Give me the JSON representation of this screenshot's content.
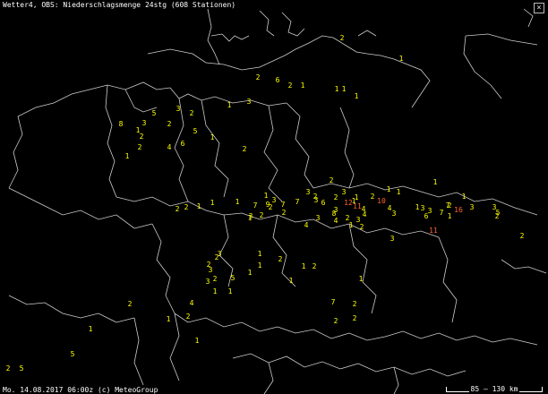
{
  "header": {
    "title": "Wetter4, OBS: Niederschlagsmenge 24stg (608 Stationen)"
  },
  "footer": {
    "credit": "Mo. 14.08.2017 06:00z (c) MeteoGroup",
    "scale": "85 – 130 km"
  },
  "colors": {
    "low": "#ffff00",
    "high": "#ff6633",
    "borders": "#cccccc"
  },
  "stations": [
    "2",
    "1",
    "2",
    "6",
    "2",
    "1",
    "1",
    "1",
    "1",
    "3",
    "1",
    "5",
    "3",
    "2",
    "8",
    "3",
    "1",
    "2",
    "2",
    "5",
    "6",
    "1",
    "4",
    "2",
    "1",
    "2",
    "2",
    "1",
    "1",
    "1",
    "1",
    "1",
    "3",
    "7",
    "2",
    "9",
    "7",
    "7",
    "3",
    "2",
    "3",
    "6",
    "2",
    "3",
    "1",
    "12",
    "11",
    "10",
    "2",
    "1",
    "2",
    "2",
    "1",
    "1",
    "1",
    "3",
    "2",
    "2",
    "1",
    "3",
    "8",
    "2",
    "4",
    "4",
    "4",
    "1",
    "3",
    "7",
    "3",
    "2",
    "3",
    "3",
    "4",
    "3",
    "4",
    "3",
    "7",
    "6",
    "16",
    "11",
    "1",
    "2",
    "3",
    "5",
    "2",
    "1",
    "3",
    "1",
    "3",
    "2",
    "2",
    "1",
    "2",
    "1",
    "2",
    "1",
    "3",
    "5",
    "2",
    "3",
    "1",
    "1",
    "2",
    "4",
    "7",
    "2",
    "2",
    "1",
    "1",
    "1",
    "2",
    "2",
    "1",
    "1",
    "5",
    "2",
    "5",
    "2"
  ]
}
